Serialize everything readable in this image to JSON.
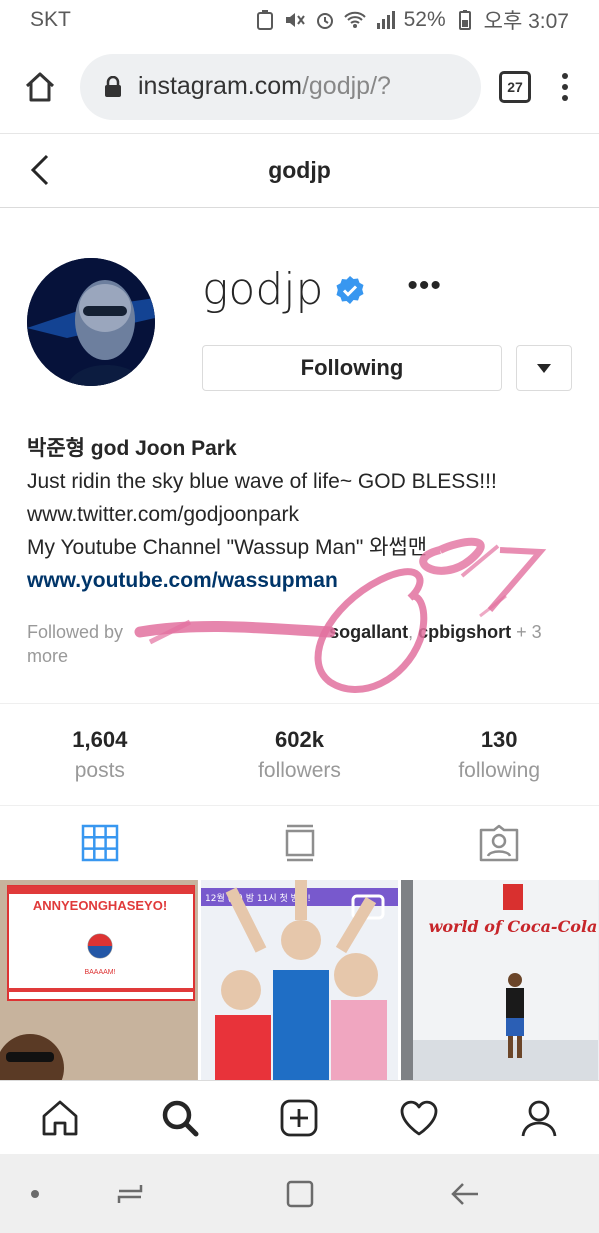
{
  "status_bar": {
    "carrier": "SKT",
    "battery": "52%",
    "time": "오후 3:07"
  },
  "browser": {
    "url_host": "instagram.com",
    "url_path": "/godjp/?",
    "tab_count": "27"
  },
  "header": {
    "title": "godjp"
  },
  "profile": {
    "username": "godjp",
    "more_label": "•••",
    "following_label": "Following",
    "full_name": "박준형 god Joon Park",
    "bio_lines": [
      "Just ridin the sky blue wave of life~ GOD BLESS!!!",
      "www.twitter.com/godjoonpark",
      "My Youtube Channel \"Wassup Man\" 와썹맨"
    ],
    "website": "www.youtube.com/wassupman",
    "followed_by_label": "Followed by",
    "followed_by_users": [
      "sogallant",
      "cpbigshort"
    ],
    "followed_by_more": "+ 3 more"
  },
  "stats": [
    {
      "value": "1,604",
      "label": "posts"
    },
    {
      "value": "602k",
      "label": "followers"
    },
    {
      "value": "130",
      "label": "following"
    }
  ],
  "posts": [
    {
      "text": "ANNYEONGHASEYO!",
      "subtext": "BAAAAM!"
    },
    {
      "text": "12월 (목) 밤 11시 첫 방송!"
    },
    {
      "text": "world of Coca-Cola"
    }
  ],
  "colors": {
    "verified": "#3897f0",
    "link": "#003569",
    "grid_active": "#3897f0",
    "scribble": "#e2719f"
  }
}
